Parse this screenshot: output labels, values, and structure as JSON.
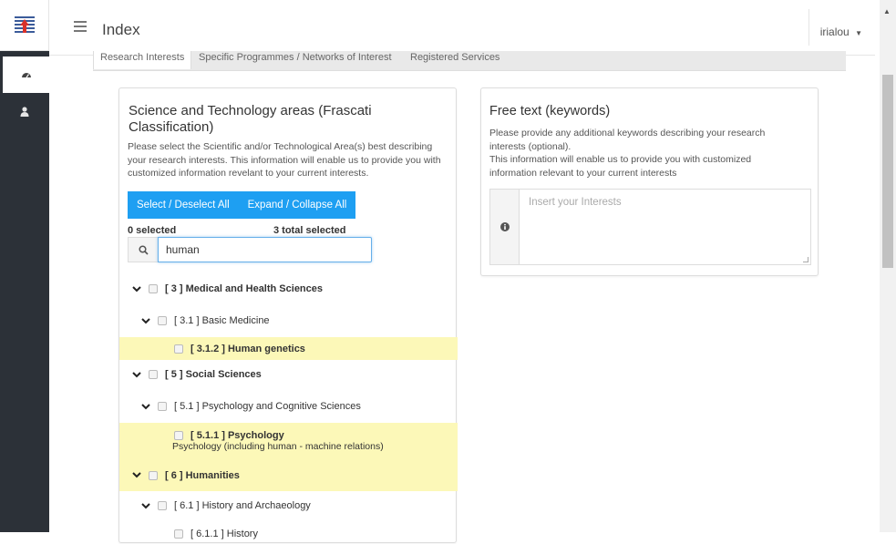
{
  "header": {
    "title": "Index",
    "user": "irialou"
  },
  "tabs": [
    {
      "label": "Research Interests",
      "active": true
    },
    {
      "label": "Specific Programmes / Networks of Interest",
      "active": false
    },
    {
      "label": "Registered Services",
      "active": false
    }
  ],
  "left_panel": {
    "title": "Science and Technology areas (Frascati Classification)",
    "description": "Please select the Scientific and/or Technological Area(s) best describing your research interests. This information will enable us to provide you with customized information revelant to your current interests.",
    "select_all_label": "Select / Deselect All",
    "expand_all_label": "Expand / Collapse All",
    "selected_count": "0 selected",
    "total_selected": "3 total selected",
    "search_value": "human",
    "tree": [
      {
        "label": "[ 3 ] Medical and Health Sciences",
        "bold": true,
        "level": 0,
        "chevron": true,
        "highlight": false
      },
      {
        "label": "[ 3.1 ] Basic Medicine",
        "bold": false,
        "level": 1,
        "chevron": true,
        "highlight": false
      },
      {
        "label": "[ 3.1.2 ] Human genetics",
        "bold": true,
        "level": 2,
        "chevron": false,
        "highlight": true
      },
      {
        "label": "[ 5 ] Social Sciences",
        "bold": true,
        "level": 0,
        "chevron": true,
        "highlight": false
      },
      {
        "label": "[ 5.1 ] Psychology and Cognitive Sciences",
        "bold": false,
        "level": 1,
        "chevron": true,
        "highlight": false
      },
      {
        "label": "[ 5.1.1 ] Psychology",
        "sub": "Psychology (including human - machine relations)",
        "bold": true,
        "level": 2,
        "chevron": false,
        "highlight": true
      },
      {
        "label": "[ 6 ] Humanities",
        "bold": true,
        "level": 0,
        "chevron": true,
        "highlight": true
      },
      {
        "label": "[ 6.1 ] History and Archaeology",
        "bold": false,
        "level": 1,
        "chevron": true,
        "highlight": false
      },
      {
        "label": "[ 6.1.1 ] History",
        "bold": false,
        "level": 2,
        "chevron": false,
        "highlight": false
      }
    ]
  },
  "right_panel": {
    "title": "Free text (keywords)",
    "description_lines": [
      "Please provide any additional keywords describing your research",
      "interests (optional).",
      "This information will enable us to provide you with customized",
      "information relevant to your current interests"
    ],
    "placeholder": "Insert your Interests"
  },
  "colors": {
    "accent": "#1e9ff2",
    "highlight": "#fcf8b8",
    "sidebar": "#2c3138"
  }
}
